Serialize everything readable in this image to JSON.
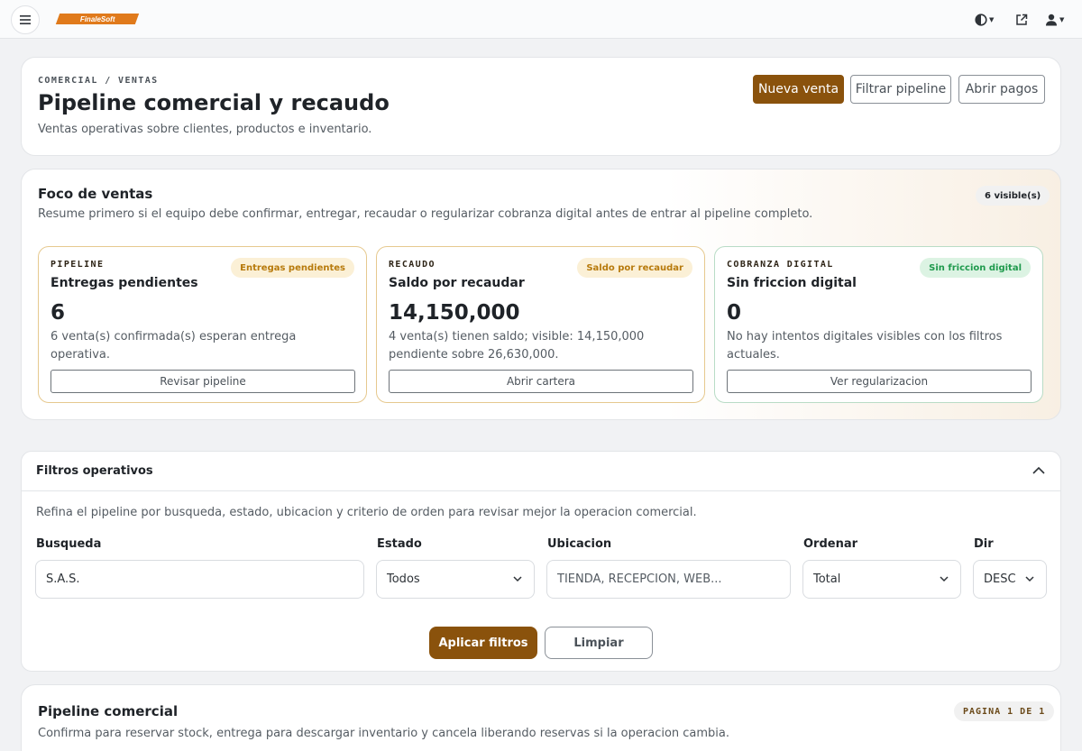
{
  "topbar": {
    "logo_text": "FinaleSoft",
    "icons": [
      "menu-icon",
      "theme-icon",
      "external-link-icon",
      "user-icon"
    ]
  },
  "header": {
    "breadcrumb": "COMERCIAL / VENTAS",
    "title": "Pipeline comercial y recaudo",
    "subtitle": "Ventas operativas sobre clientes, productos e inventario.",
    "actions": {
      "new_sale": "Nueva venta",
      "filter_pipeline": "Filtrar pipeline",
      "open_payments": "Abrir pagos"
    }
  },
  "focus": {
    "title": "Foco de ventas",
    "description": "Resume primero si el equipo debe confirmar, entregar, recaudar o regularizar cobranza digital antes de entrar al pipeline completo.",
    "visible_badge": "6 visible(s)",
    "cards": [
      {
        "eyebrow": "PIPELINE",
        "badge": "Entregas pendientes",
        "title": "Entregas pendientes",
        "value": "6",
        "description": "6 venta(s) confirmada(s) esperan entrega operativa.",
        "button": "Revisar pipeline"
      },
      {
        "eyebrow": "RECAUDO",
        "badge": "Saldo por recaudar",
        "title": "Saldo por recaudar",
        "value": "14,150,000",
        "description": "4 venta(s) tienen saldo; visible: 14,150,000 pendiente sobre 26,630,000.",
        "button": "Abrir cartera"
      },
      {
        "eyebrow": "COBRANZA DIGITAL",
        "badge": "Sin friccion digital",
        "title": "Sin friccion digital",
        "value": "0",
        "description": "No hay intentos digitales visibles con los filtros actuales.",
        "button": "Ver regularizacion"
      }
    ]
  },
  "filters": {
    "title": "Filtros operativos",
    "description": "Refina el pipeline por busqueda, estado, ubicacion y criterio de orden para revisar mejor la operacion comercial.",
    "search": {
      "label": "Busqueda",
      "value": "S.A.S."
    },
    "status": {
      "label": "Estado",
      "value": "Todos"
    },
    "location": {
      "label": "Ubicacion",
      "value": "TIENDA, RECEPCION, WEB..."
    },
    "order": {
      "label": "Ordenar",
      "value": "Total"
    },
    "direction": {
      "label": "Dir",
      "value": "DESC"
    },
    "apply": "Aplicar filtros",
    "clear": "Limpiar"
  },
  "pipeline": {
    "title": "Pipeline comercial",
    "description": "Confirma para reservar stock, entrega para descargar inventario y cancela liberando reservas si la operacion cambia.",
    "page_badge": "PAGINA 1 DE 1"
  },
  "colors": {
    "accent": "#8a520c",
    "amber_border": "#e6c98f",
    "green_border": "#b9dcc6",
    "amber_badge_bg": "#fbf0d6",
    "amber_badge_text": "#b77a0c",
    "green_badge_bg": "#dcf3e3",
    "green_badge_text": "#1f9a4d"
  }
}
